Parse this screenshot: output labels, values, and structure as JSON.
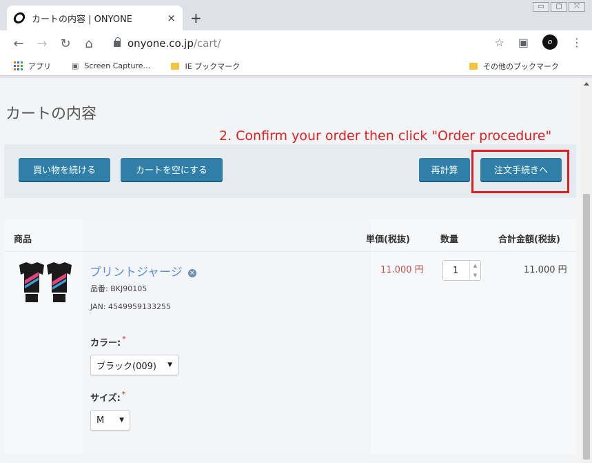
{
  "browser": {
    "tab_title": "カートの内容 | ONYONE",
    "tab_close": "×",
    "new_tab": "+",
    "url_host": "onyone.co.jp",
    "url_path": "/cart/",
    "profile_initial": "o",
    "window_controls": [
      "▭",
      "▢",
      "⤧"
    ],
    "bookmarks": {
      "apps": "アプリ",
      "screen_capture": "Screen Capture…",
      "ie_bookmarks": "IE ブックマーク",
      "other_bookmarks": "その他のブックマーク"
    }
  },
  "page": {
    "title": "カートの内容",
    "annotation": "2. Confirm your order then click \"Order procedure\"",
    "buttons": {
      "continue_shopping": "買い物を続ける",
      "empty_cart": "カートを空にする",
      "recalculate": "再計算",
      "order_procedure": "注文手続きへ"
    },
    "table": {
      "headers": {
        "product": "商品",
        "unit_price": "単価(税抜)",
        "quantity": "数量",
        "total": "合計金額(税抜)"
      },
      "item": {
        "name": "プリントジャージ",
        "remove_icon": "×",
        "sku": "品番: BKJ90105",
        "jan": "JAN: 4549959133255",
        "color_label": "カラー:",
        "color_value": "ブラック(009)",
        "size_label": "サイズ:",
        "size_value": "M",
        "required_mark": "*",
        "unit_price": "11.000 円",
        "quantity": "1",
        "line_total": "11.000 円"
      }
    }
  },
  "colors": {
    "button_blue": "#2f7fa8",
    "annotation_red": "#e02020",
    "price_red": "#c0504d",
    "link_blue": "#5a8fd0"
  }
}
